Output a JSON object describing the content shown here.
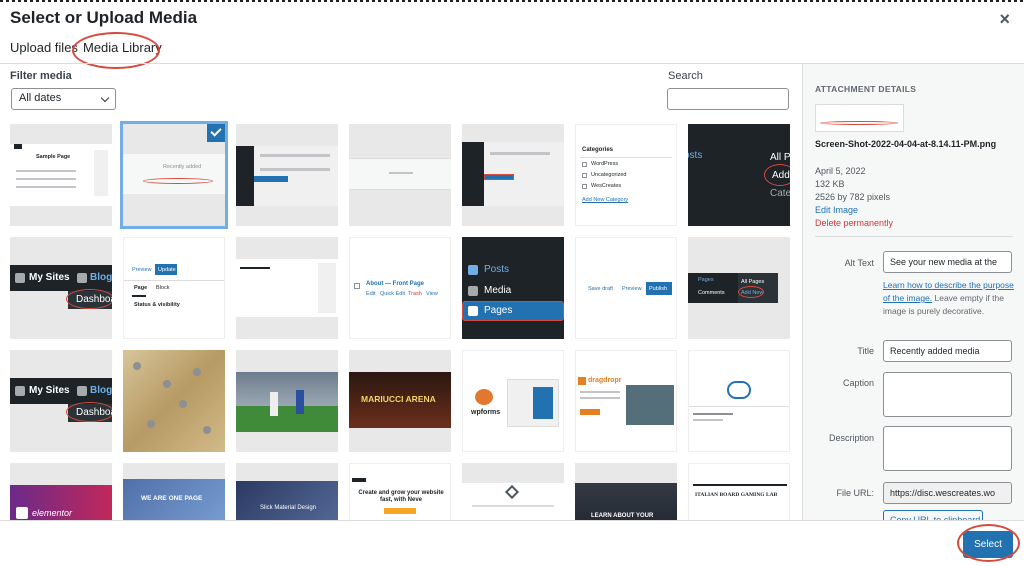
{
  "modal": {
    "title": "Select or Upload Media",
    "close_symbol": "×"
  },
  "tabs": [
    {
      "label": "Upload files"
    },
    {
      "label": "Media Library"
    }
  ],
  "filter": {
    "label": "Filter media",
    "date_value": "All dates"
  },
  "search": {
    "label": "Search",
    "value": ""
  },
  "thumbs_text": {
    "t1_title": "Sample Page",
    "t4_label": "Recently added",
    "t6_heading": "Categories",
    "t6_items": [
      "WordPress",
      "Uncategorized",
      "WesCreates"
    ],
    "t6_link": "Add New Category",
    "t7_lines": [
      "osts",
      "All P",
      "Add",
      "Cate"
    ],
    "mysites": "My Sites",
    "blog": "Blog",
    "dashboard": "Dashboa",
    "t9_preview": "Preview",
    "t9_update": "Update",
    "t9_page": "Page",
    "t9_block": "Block",
    "t9_status": "Status & visibility",
    "t11_title": "About — Front Page",
    "t11_edit": "Edit",
    "t11_quick": "Quick Edit",
    "t11_trash": "Trash",
    "t11_view": "View",
    "t12_posts": "Posts",
    "t12_media": "Media",
    "t12_pages": "Pages",
    "t13_draft": "Save draft",
    "t13_preview": "Preview",
    "t13_publish": "Publish",
    "t14_pages": "Pages",
    "t14_comments": "Comments",
    "t14_all": "All Pages",
    "t14_add": "Add New",
    "t17_arena": "MARIUCCI ARENA",
    "t18_brand": "wpforms",
    "t19_brand": "dragdropr",
    "t22_brand": "elementor",
    "t23_heading": "WE ARE ONE PAGE",
    "t24_heading": "Slick Material Design",
    "t25_heading": "Create and grow your website fast, with Neve",
    "t27_heading": "LEARN ABOUT YOUR",
    "t28_heading": "ITALIAN BOARD GAMING LAB"
  },
  "details": {
    "heading": "ATTACHMENT DETAILS",
    "filename": "Screen-Shot-2022-04-04-at-8.14.11-PM.png",
    "date": "April 5, 2022",
    "size": "132 KB",
    "dimensions": "2526 by 782 pixels",
    "edit_link": "Edit Image",
    "delete_link": "Delete permanently",
    "alt_label": "Alt Text",
    "alt_value": "See your new media at the",
    "alt_help_link": "Learn how to describe the purpose of the image.",
    "alt_help_rest": " Leave empty if the image is purely decorative.",
    "title_label": "Title",
    "title_value": "Recently added media",
    "caption_label": "Caption",
    "description_label": "Description",
    "url_label": "File URL:",
    "url_value": "https://disc.wescreates.wo",
    "copy_button": "Copy URL to clipboard"
  },
  "footer": {
    "select_button": "Select"
  },
  "colors": {
    "accent": "#2271b1",
    "annotation": "#d54b3e",
    "danger": "#d63638",
    "wp_dark": "#1d2327"
  }
}
